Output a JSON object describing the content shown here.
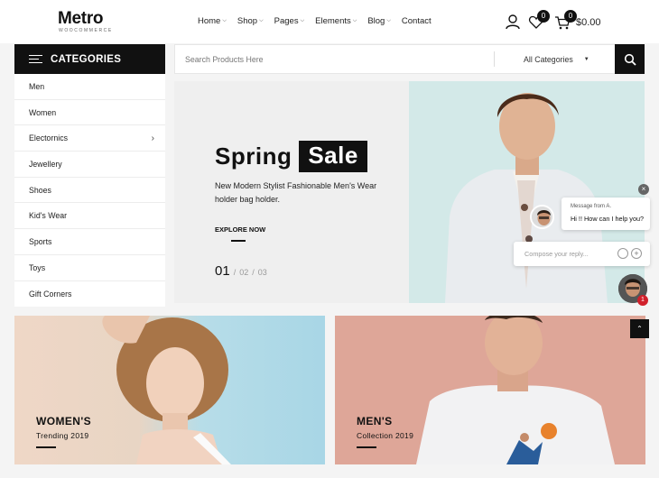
{
  "brand": {
    "name": "Metro",
    "tagline": "WOOCOMMERCE"
  },
  "nav": {
    "items": [
      {
        "label": "Home",
        "dropdown": true
      },
      {
        "label": "Shop",
        "dropdown": true
      },
      {
        "label": "Pages",
        "dropdown": true
      },
      {
        "label": "Elements",
        "dropdown": true
      },
      {
        "label": "Blog",
        "dropdown": true
      },
      {
        "label": "Contact",
        "dropdown": false
      }
    ]
  },
  "header_icons": {
    "account": "user-icon",
    "wishlist": "heart-icon",
    "cart": "cart-icon"
  },
  "wishlist_count": "0",
  "cart": {
    "count": "0",
    "total": "$0.00"
  },
  "categories": {
    "title": "CATEGORIES",
    "items": [
      {
        "label": "Men",
        "has_sub": false
      },
      {
        "label": "Women",
        "has_sub": false
      },
      {
        "label": "Electornics",
        "has_sub": true
      },
      {
        "label": "Jewellery",
        "has_sub": false
      },
      {
        "label": "Shoes",
        "has_sub": false
      },
      {
        "label": "Kid's Wear",
        "has_sub": false
      },
      {
        "label": "Sports",
        "has_sub": false
      },
      {
        "label": "Toys",
        "has_sub": false
      },
      {
        "label": "Gift Corners",
        "has_sub": false
      }
    ]
  },
  "search": {
    "placeholder": "Search Products Here",
    "category": "All Categories"
  },
  "hero": {
    "title_word1": "Spring",
    "title_word2": "Sale",
    "description": "New Modern Stylist Fashionable Men's Wear holder bag holder.",
    "cta": "EXPLORE NOW",
    "current_slide": "01",
    "slides": [
      "02",
      "03"
    ],
    "separator": "/"
  },
  "banners": [
    {
      "title": "WOMEN'S",
      "subtitle": "Trending 2019"
    },
    {
      "title": "MEN'S",
      "subtitle": "Collection 2019"
    }
  ],
  "chat": {
    "from": "Message from A.",
    "message": "Hi !! How can I help you?",
    "compose_placeholder": "Compose your reply...",
    "unread": "1"
  },
  "colors": {
    "primary": "#111111",
    "accent_red": "#d1202b",
    "background": "#f4f4f4"
  }
}
